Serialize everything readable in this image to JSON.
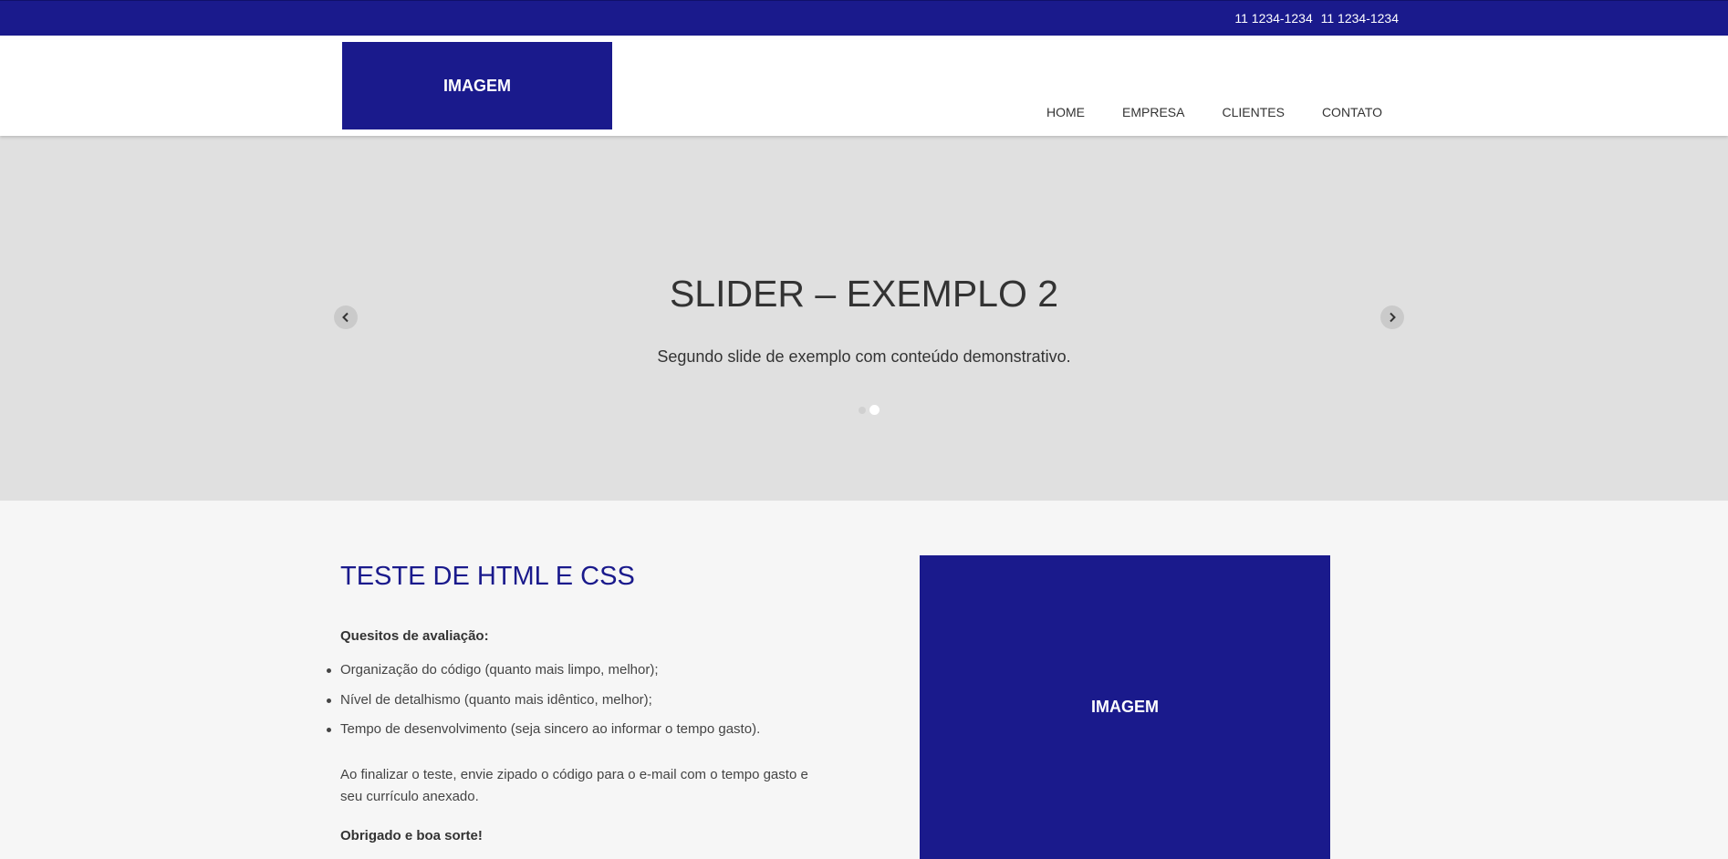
{
  "colors": {
    "brand": "#1a1a8c",
    "slider_bg": "#e0e0e0",
    "content_bg": "#f6f6f6",
    "text": "#333333"
  },
  "topbar": {
    "phone_1": "11 1234-1234",
    "phone_2": "11 1234-1234"
  },
  "header": {
    "logo_label": "IMAGEM",
    "nav": [
      {
        "label": "HOME"
      },
      {
        "label": "EMPRESA"
      },
      {
        "label": "CLIENTES"
      },
      {
        "label": "CONTATO"
      }
    ]
  },
  "slider": {
    "title": "SLIDER – EXEMPLO 2",
    "description": "Segundo slide de exemplo com conteúdo demonstrativo.",
    "prev_icon": "chevron-left-icon",
    "next_icon": "chevron-right-icon",
    "slide_count": 2,
    "active_slide": 2
  },
  "content": {
    "title": "TESTE DE HTML E CSS",
    "subhead": "Quesitos de avaliação:",
    "items": [
      "Organização do código (quanto mais limpo, melhor);",
      "Nível de detalhismo (quanto mais idêntico, melhor);",
      "Tempo de desenvolvimento (seja sincero ao informar o tempo gasto)."
    ],
    "paragraph": "Ao finalizar o teste, envie zipado o código para o e-mail com o tempo gasto e seu currículo anexado.",
    "thanks": "Obrigado e boa sorte!",
    "image_label": "IMAGEM"
  }
}
